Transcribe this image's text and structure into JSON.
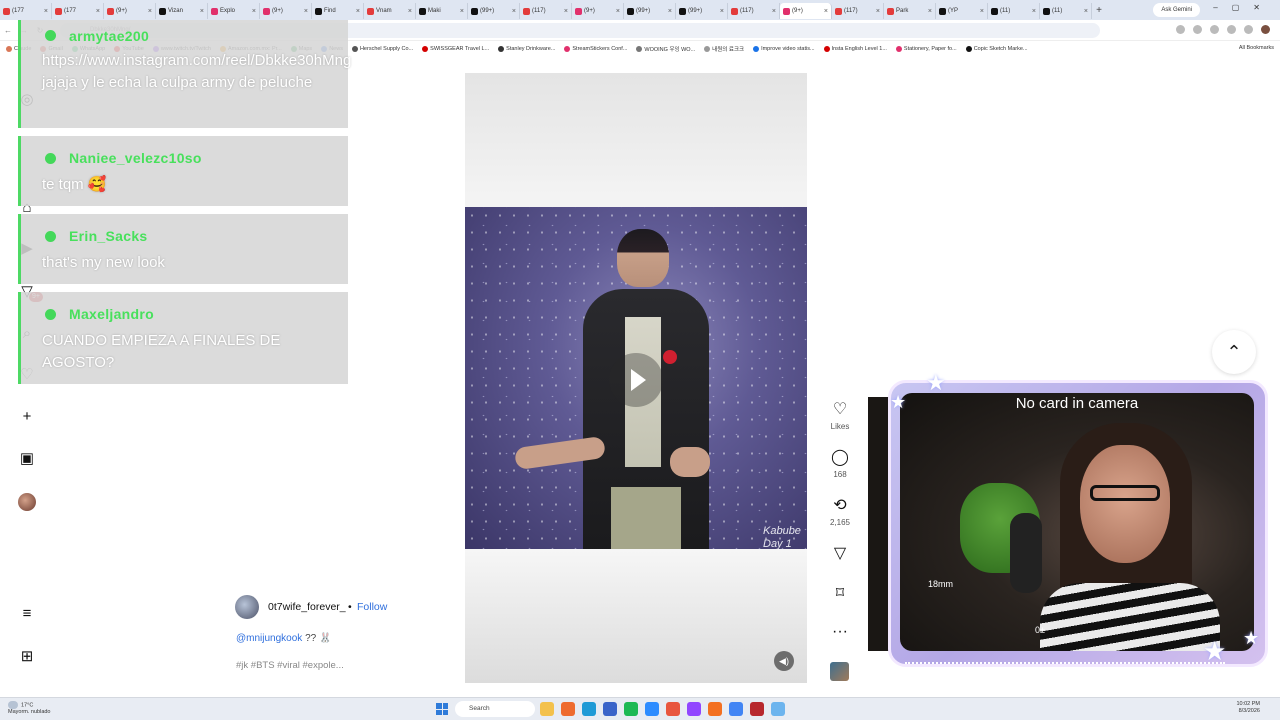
{
  "browser": {
    "tabs": [
      {
        "label": "(177",
        "color": "#e33b3b"
      },
      {
        "label": "(177",
        "color": "#e33b3b"
      },
      {
        "label": "(9+)",
        "color": "#e33b3b"
      },
      {
        "label": "Vizan",
        "color": "#111111"
      },
      {
        "label": "Explo",
        "color": "#e1306c"
      },
      {
        "label": "(9+)",
        "color": "#e1306c"
      },
      {
        "label": "Find",
        "color": "#111111"
      },
      {
        "label": "Vnam",
        "color": "#e33b3b"
      },
      {
        "label": "Maki",
        "color": "#111111"
      },
      {
        "label": "(99+)",
        "color": "#111111"
      },
      {
        "label": "(117)",
        "color": "#e33b3b"
      },
      {
        "label": "(9+)",
        "color": "#e1306c"
      },
      {
        "label": "(99+)",
        "color": "#111111"
      },
      {
        "label": "(99+)",
        "color": "#111111"
      },
      {
        "label": "(117)",
        "color": "#e33b3b"
      },
      {
        "label": "(9+)",
        "color": "#e1306c",
        "active": true
      },
      {
        "label": "(117)",
        "color": "#e33b3b"
      },
      {
        "label": "Park",
        "color": "#e33b3b"
      },
      {
        "label": "(YP",
        "color": "#111111"
      },
      {
        "label": "(11)",
        "color": "#111111"
      },
      {
        "label": "(11)",
        "color": "#111111"
      }
    ],
    "gemini_label": "Ask Gemini",
    "url": "Dbkke30hMng/",
    "bookmarks": [
      {
        "label": "Claude",
        "color": "#d97757"
      },
      {
        "label": "Gmail",
        "color": "#ea4335"
      },
      {
        "label": "WhatsApp",
        "color": "#25d366"
      },
      {
        "label": "YouTube",
        "color": "#ff0000"
      },
      {
        "label": "www.twitch.tv/Twitch",
        "color": "#9146ff"
      },
      {
        "label": "Amazon.com.mx: Pr...",
        "color": "#ff9900"
      },
      {
        "label": "Maps",
        "color": "#34a853"
      },
      {
        "label": "News",
        "color": "#4285f4"
      },
      {
        "label": "Herschel Supply Co...",
        "color": "#555555"
      },
      {
        "label": "SWISSGEAR Travel L...",
        "color": "#d40000"
      },
      {
        "label": "Stanley Drinkware...",
        "color": "#333333"
      },
      {
        "label": "StreamStickers Conf...",
        "color": "#e1306c"
      },
      {
        "label": "WOOING 우잉 WO...",
        "color": "#777777"
      },
      {
        "label": "내원의 료크크",
        "color": "#999999"
      },
      {
        "label": "Improve video statis...",
        "color": "#1a73e8"
      },
      {
        "label": "Insta English Level 1...",
        "color": "#d40000"
      },
      {
        "label": "Stationery, Paper fo...",
        "color": "#e1306c"
      },
      {
        "label": "Copic Sketch Marke...",
        "color": "#111111"
      }
    ],
    "all_bookmarks": "All Bookmarks"
  },
  "chat": [
    {
      "user": "armytae200",
      "text": "https://www.instagram.com/reel/Dbkke30hMng jajaja y le echa la culpa army de peluche"
    },
    {
      "user": "Naniee_velezc10so",
      "text": "te tqm 🥰"
    },
    {
      "user": "Erin_Sacks",
      "text": "that's my new look"
    },
    {
      "user": "Maxeljandro",
      "text": "CUANDO EMPIEZA A FINALES DE AGOSTO?"
    }
  ],
  "nav": {
    "notification_badge": "9+"
  },
  "video": {
    "watermark": "Kabube Day 1 08"
  },
  "post": {
    "username": "0t7wife_forever_",
    "separator": "•",
    "follow": "Follow",
    "mention": "@mnijungkook",
    "caption_rest": " ?? 🐰",
    "hashtags": "#jk #BTS #viral #expole..."
  },
  "actions": {
    "likes_label": "Likes",
    "comments": "168",
    "reposts": "2,165"
  },
  "webcam": {
    "caption": "No card in camera",
    "focal": "18mm",
    "exposure": "0±"
  },
  "taskbar": {
    "temperature": "17°C",
    "weather": "Mayorm. nublado",
    "search": "Search",
    "time": "10:02 PM",
    "date": "8/3/2026"
  }
}
